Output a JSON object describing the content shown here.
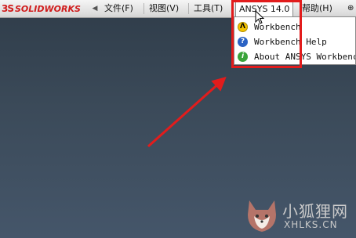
{
  "app": {
    "logo_mark": "3S",
    "logo_text": "SOLIDWORKS"
  },
  "menubar": {
    "items": [
      {
        "label": "文件(F)"
      },
      {
        "label": "视图(V)"
      },
      {
        "label": "工具(T)"
      },
      {
        "label": "ANSYS 14.0"
      },
      {
        "label": "帮助(H)"
      }
    ],
    "trailing_glyph": "⊕"
  },
  "dropdown": {
    "items": [
      {
        "label": "Workbench",
        "icon": "workbench-icon",
        "icon_glyph": "Λ"
      },
      {
        "label": "Workbench Help",
        "icon": "help-icon",
        "icon_glyph": "?"
      },
      {
        "label": "About ANSYS Workbench",
        "icon": "info-icon",
        "icon_glyph": "i"
      }
    ]
  },
  "annotation": {
    "highlight_color": "#e21c1c",
    "arrow_color": "#e21c1c"
  },
  "watermark": {
    "title": "小狐狸网",
    "url": "XHLKS.CN"
  }
}
